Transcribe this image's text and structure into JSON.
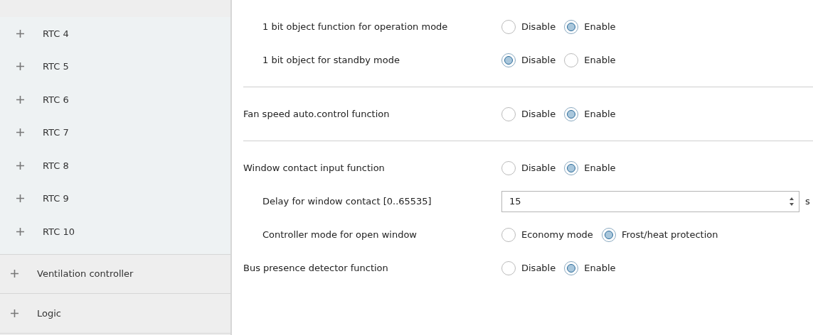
{
  "sidebar": {
    "groups": [
      {
        "items": [
          {
            "label": "RTC 4"
          },
          {
            "label": "RTC 5"
          },
          {
            "label": "RTC 6"
          },
          {
            "label": "RTC 7"
          },
          {
            "label": "RTC 8"
          },
          {
            "label": "RTC 9"
          },
          {
            "label": "RTC 10"
          }
        ]
      },
      {
        "items": [
          {
            "label": "Ventilation controller"
          }
        ]
      },
      {
        "items": [
          {
            "label": "Logic"
          }
        ]
      }
    ]
  },
  "settings": [
    {
      "kind": "radio",
      "label": "1 bit object function for operation mode",
      "indent": true,
      "options": [
        {
          "label": "Disable",
          "selected": false
        },
        {
          "label": "Enable",
          "selected": true
        }
      ]
    },
    {
      "kind": "radio",
      "label": "1 bit object for standby mode",
      "indent": true,
      "options": [
        {
          "label": "Disable",
          "selected": true
        },
        {
          "label": "Enable",
          "selected": false
        }
      ]
    },
    {
      "kind": "divider"
    },
    {
      "kind": "radio",
      "label": "Fan speed auto.control function",
      "indent": false,
      "options": [
        {
          "label": "Disable",
          "selected": false
        },
        {
          "label": "Enable",
          "selected": true
        }
      ]
    },
    {
      "kind": "divider"
    },
    {
      "kind": "radio",
      "label": "Window contact input function",
      "indent": false,
      "options": [
        {
          "label": "Disable",
          "selected": false
        },
        {
          "label": "Enable",
          "selected": true
        }
      ]
    },
    {
      "kind": "number",
      "label": "Delay for window contact [0..65535]",
      "indent": true,
      "value": "15",
      "unit": "s"
    },
    {
      "kind": "radio",
      "label": "Controller mode for open window",
      "indent": true,
      "options": [
        {
          "label": "Economy mode",
          "selected": false
        },
        {
          "label": "Frost/heat protection",
          "selected": true
        }
      ]
    },
    {
      "kind": "radio",
      "label": "Bus presence detector function",
      "indent": false,
      "options": [
        {
          "label": "Disable",
          "selected": false
        },
        {
          "label": "Enable",
          "selected": true
        }
      ]
    }
  ]
}
